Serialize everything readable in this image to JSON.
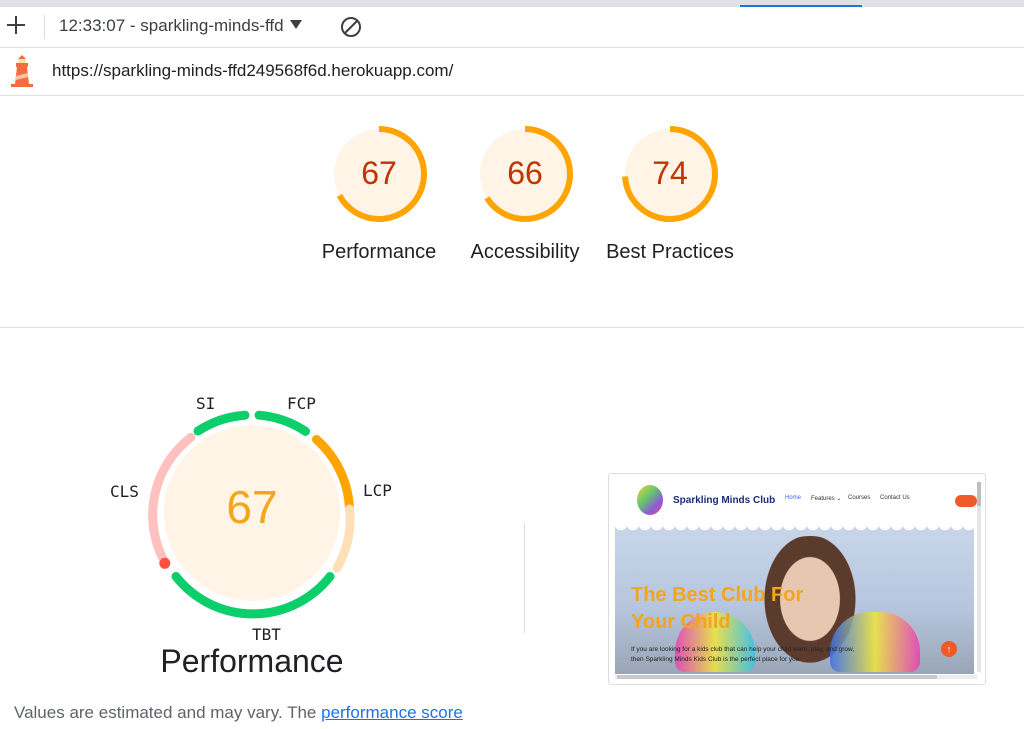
{
  "toolbar": {
    "report_label": "12:33:07 - sparkling-minds-ffd",
    "add_icon": "plus-icon",
    "clear_icon": "block-icon"
  },
  "urlbar": {
    "url": "https://sparkling-minds-ffd249568f6d.herokuapp.com/"
  },
  "summary_gauges": [
    {
      "score": "67",
      "label": "Performance"
    },
    {
      "score": "66",
      "label": "Accessibility"
    },
    {
      "score": "74",
      "label": "Best Practices"
    }
  ],
  "performance": {
    "score": "67",
    "title": "Performance",
    "metrics": {
      "si": "SI",
      "fcp": "FCP",
      "lcp": "LCP",
      "tbt": "TBT",
      "cls": "CLS"
    }
  },
  "screenshot": {
    "brand": "Sparkling Minds Club",
    "nav": {
      "home": "Home",
      "features": "Features ⌄",
      "courses": "Courses",
      "contact": "Contact Us"
    },
    "heading": "The Best Club For Your Child",
    "paragraph": "If you are looking for a kids club that can help your child learn, play, and grow, then Sparkling Minds Kids Club is the perfect place for you",
    "to_top": "↑"
  },
  "footer": {
    "text": "Values are estimated and may vary. The ",
    "link": "performance score"
  },
  "colors": {
    "score_text": "#c33300",
    "average": "#ffa400",
    "pass": "#0cce6b",
    "fail": "#ff4e42",
    "link": "#1a73e8"
  }
}
